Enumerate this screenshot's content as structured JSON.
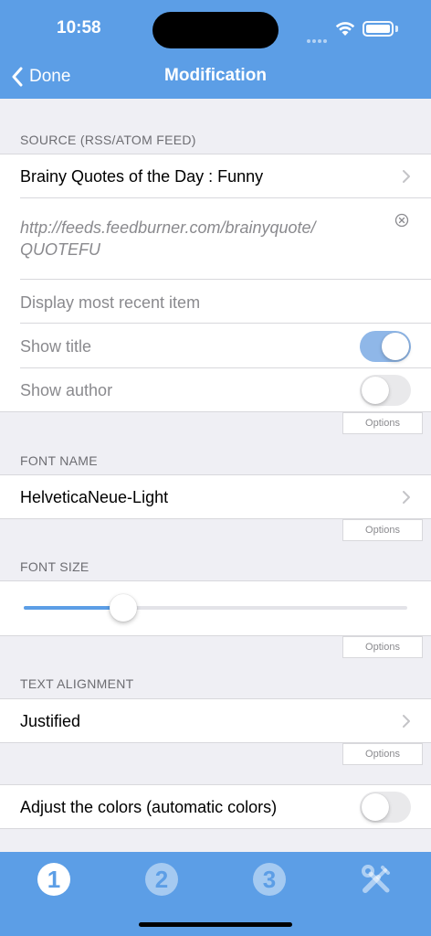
{
  "status_bar": {
    "time": "10:58"
  },
  "nav": {
    "back_label": "Done",
    "title": "Modification"
  },
  "source": {
    "header": "SOURCE (RSS/ATOM FEED)",
    "feed_name": "Brainy Quotes of the Day : Funny",
    "url_line1": "http://feeds.feedburner.com/brainyquote/",
    "url_line2": "QUOTEFU",
    "display_label": "Display most recent item",
    "show_title_label": "Show title",
    "show_title_on": true,
    "show_author_label": "Show author",
    "show_author_on": false,
    "options_label": "Options"
  },
  "font_name": {
    "header": "FONT NAME",
    "value": "HelveticaNeue-Light",
    "options_label": "Options"
  },
  "font_size": {
    "header": "FONT SIZE",
    "slider_fraction": 0.26,
    "options_label": "Options"
  },
  "text_alignment": {
    "header": "TEXT ALIGNMENT",
    "value": "Justified",
    "options_label": "Options"
  },
  "colors": {
    "adjust_label": "Adjust the colors (automatic colors)",
    "adjust_on": false
  },
  "tabbar": {
    "tabs": [
      {
        "label": "1",
        "active": true
      },
      {
        "label": "2",
        "active": false
      },
      {
        "label": "3",
        "active": false
      },
      {
        "icon": "tools-icon",
        "active": false
      }
    ]
  },
  "theme": {
    "accent": "#5c9ee6",
    "toggle_on": "#8fb7e8",
    "background": "#efeff4"
  }
}
